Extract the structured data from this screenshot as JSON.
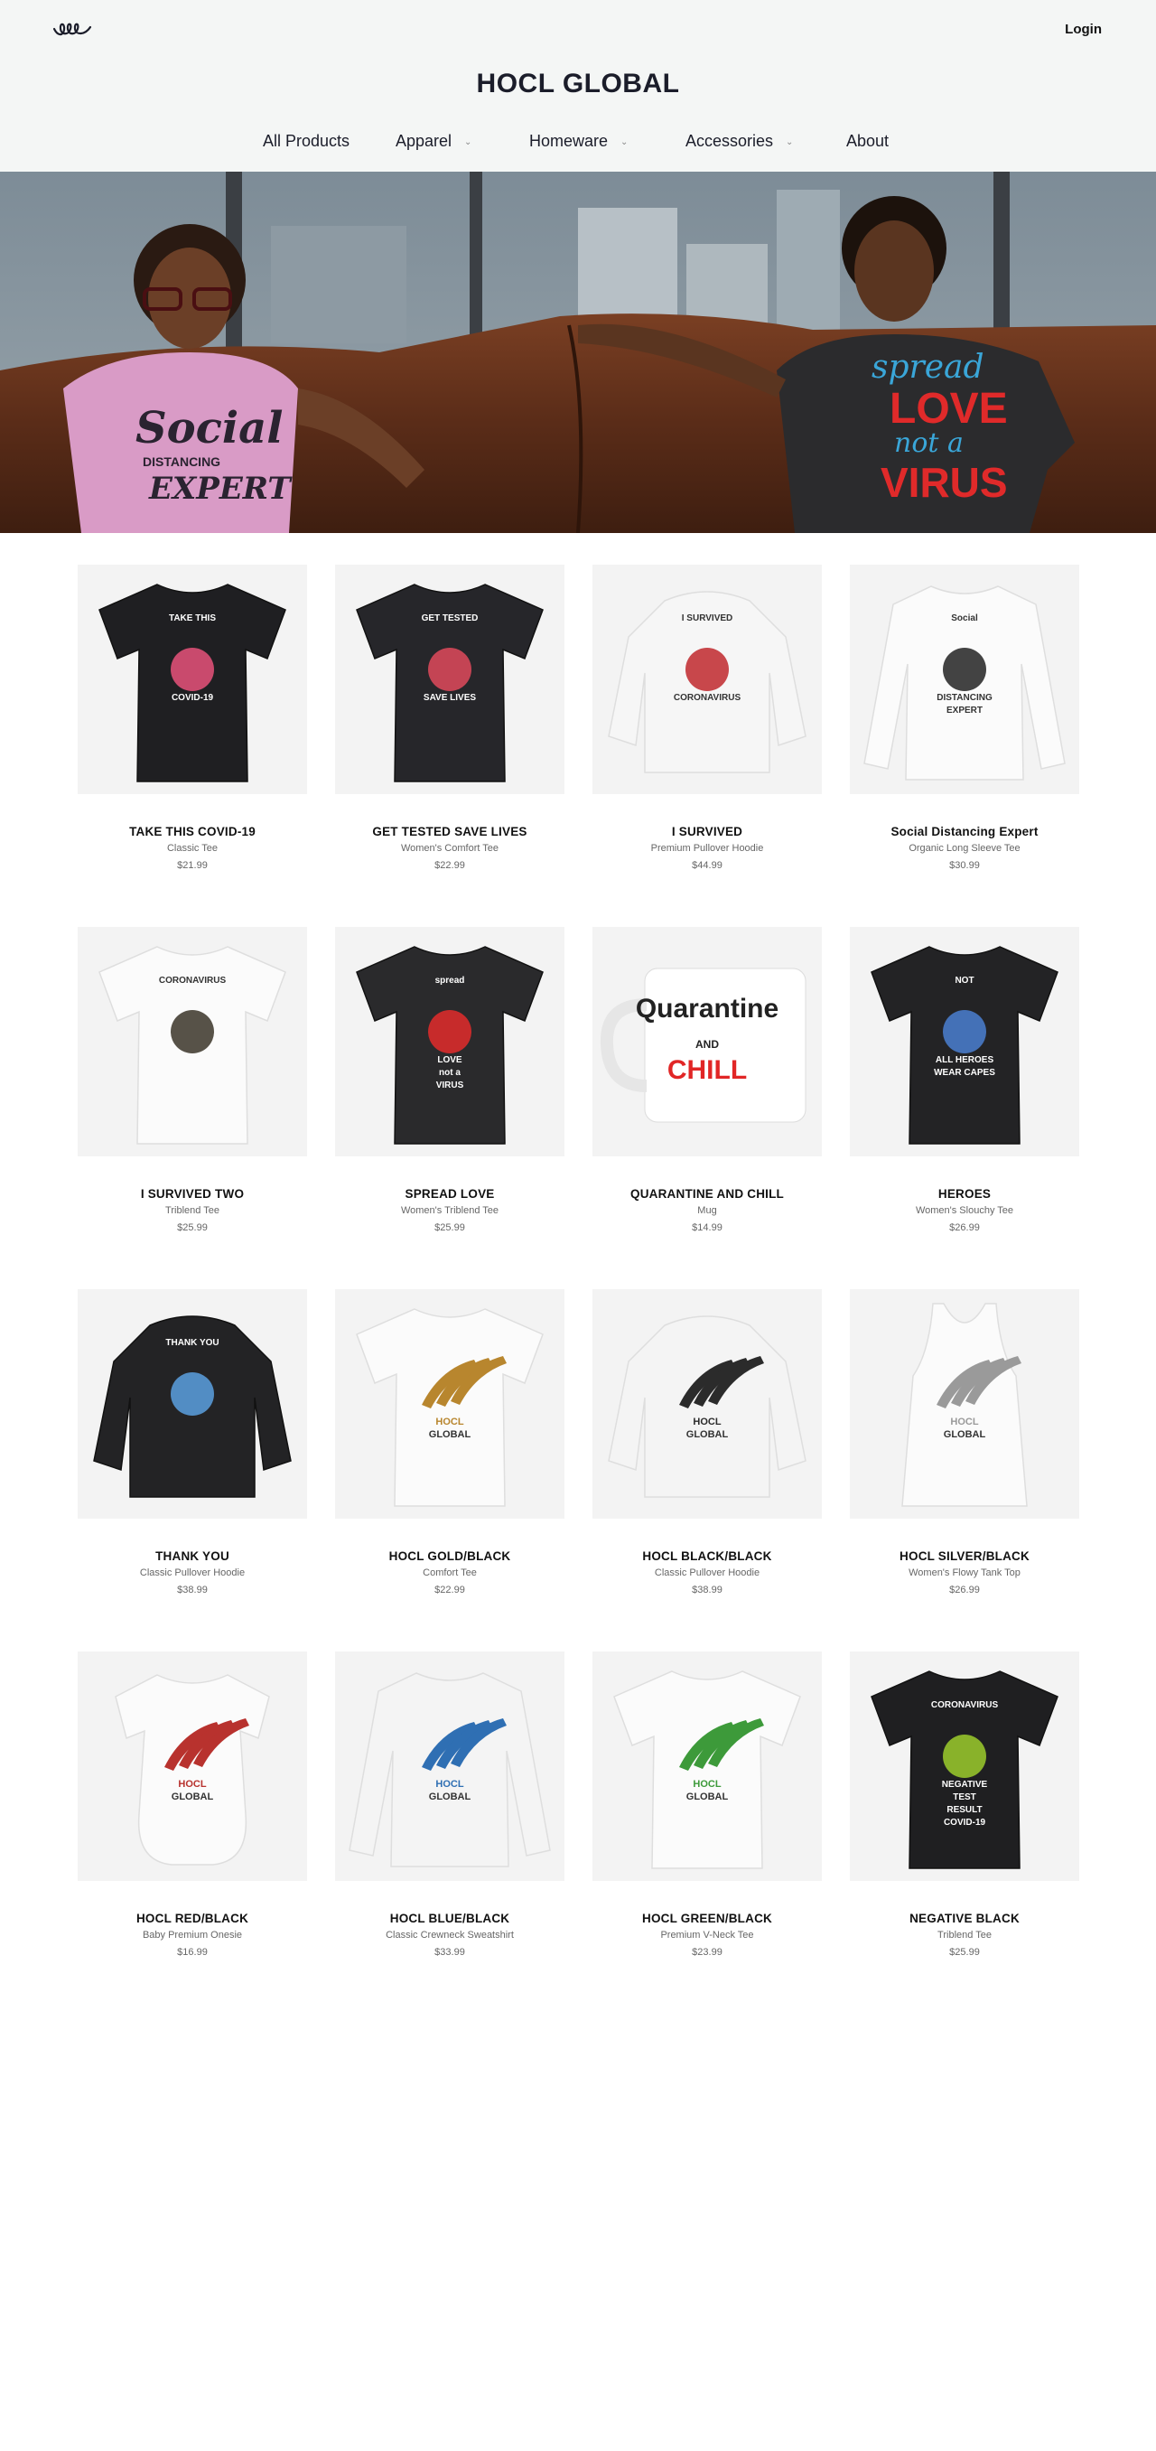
{
  "header": {
    "login_label": "Login",
    "brand_title": "HOCL GLOBAL",
    "logo_icon": "loop-logo-icon"
  },
  "nav": [
    {
      "label": "All Products",
      "has_dropdown": false
    },
    {
      "label": "Apparel",
      "has_dropdown": true
    },
    {
      "label": "Homeware",
      "has_dropdown": true
    },
    {
      "label": "Accessories",
      "has_dropdown": true
    },
    {
      "label": "About",
      "has_dropdown": false
    }
  ],
  "hero": {
    "left_shirt_lines": [
      "Social",
      "DISTANCING",
      "EXPERT"
    ],
    "right_shirt_lines": [
      "spread",
      "LOVE",
      "not a",
      "VIRUS"
    ]
  },
  "products": [
    {
      "name": "TAKE THIS COVID-19",
      "type": "Classic Tee",
      "price": "$21.99",
      "garment": "tee",
      "color": "#1f1f22",
      "print": [
        "TAKE THIS",
        "COVID-19"
      ],
      "accent": "#e8527a"
    },
    {
      "name": "GET TESTED SAVE LIVES",
      "type": "Women's Comfort Tee",
      "price": "$22.99",
      "garment": "tee",
      "color": "#26262a",
      "print": [
        "GET TESTED",
        "SAVE LIVES"
      ],
      "accent": "#e04a5c"
    },
    {
      "name": "I SURVIVED",
      "type": "Premium Pullover Hoodie",
      "price": "$44.99",
      "garment": "hoodie",
      "color": "#f6f6f6",
      "print": [
        "I SURVIVED",
        "CORONAVIRUS"
      ],
      "accent": "#c0282d"
    },
    {
      "name": "Social Distancing Expert",
      "type": "Organic Long Sleeve Tee",
      "price": "$30.99",
      "garment": "longsleeve",
      "color": "#fbfbfb",
      "print": [
        "Social",
        "DISTANCING",
        "EXPERT"
      ],
      "accent": "#222222"
    },
    {
      "name": "I SURVIVED TWO",
      "type": "Triblend Tee",
      "price": "$25.99",
      "garment": "tee",
      "color": "#fbfbfb",
      "print": [
        "CORONAVIRUS"
      ],
      "accent": "#3a3428"
    },
    {
      "name": "SPREAD LOVE",
      "type": "Women's Triblend Tee",
      "price": "$25.99",
      "garment": "tee",
      "color": "#2a2a2c",
      "print": [
        "spread",
        "LOVE",
        "not a",
        "VIRUS"
      ],
      "accent": "#e32b2b"
    },
    {
      "name": "QUARANTINE AND CHILL",
      "type": "Mug",
      "price": "$14.99",
      "garment": "mug",
      "color": "#ffffff",
      "print": [
        "Quarantine",
        "AND",
        "CHILL"
      ],
      "accent": "#e12626"
    },
    {
      "name": "HEROES",
      "type": "Women's Slouchy Tee",
      "price": "$26.99",
      "garment": "tee",
      "color": "#232325",
      "print": [
        "NOT",
        "ALL HEROES",
        "WEAR CAPES"
      ],
      "accent": "#4a7fd1"
    },
    {
      "name": "THANK YOU",
      "type": "Classic Pullover Hoodie",
      "price": "$38.99",
      "garment": "hoodie",
      "color": "#232325",
      "print": [
        "THANK YOU"
      ],
      "accent": "#5aa0e0"
    },
    {
      "name": "HOCL GOLD/BLACK",
      "type": "Comfort Tee",
      "price": "$22.99",
      "garment": "tee",
      "color": "#fbfbfb",
      "print": [
        "HOCL",
        "GLOBAL"
      ],
      "accent": "#b8862e"
    },
    {
      "name": "HOCL BLACK/BLACK",
      "type": "Classic Pullover Hoodie",
      "price": "$38.99",
      "garment": "hoodie",
      "color": "#f4f4f4",
      "print": [
        "HOCL",
        "GLOBAL"
      ],
      "accent": "#2b2b2b"
    },
    {
      "name": "HOCL SILVER/BLACK",
      "type": "Women's Flowy Tank Top",
      "price": "$26.99",
      "garment": "tank",
      "color": "#fbfbfb",
      "print": [
        "HOCL",
        "GLOBAL"
      ],
      "accent": "#9a9a9a"
    },
    {
      "name": "HOCL RED/BLACK",
      "type": "Baby Premium Onesie",
      "price": "$16.99",
      "garment": "onesie",
      "color": "#fbfbfb",
      "print": [
        "HOCL",
        "GLOBAL"
      ],
      "accent": "#b8322e"
    },
    {
      "name": "HOCL BLUE/BLACK",
      "type": "Classic Crewneck Sweatshirt",
      "price": "$33.99",
      "garment": "longsleeve",
      "color": "#f4f4f4",
      "print": [
        "HOCL",
        "GLOBAL"
      ],
      "accent": "#2f6fb3"
    },
    {
      "name": "HOCL GREEN/BLACK",
      "type": "Premium V-Neck Tee",
      "price": "$23.99",
      "garment": "tee",
      "color": "#fbfbfb",
      "print": [
        "HOCL",
        "GLOBAL"
      ],
      "accent": "#3d9a3a"
    },
    {
      "name": "NEGATIVE BLACK",
      "type": "Triblend Tee",
      "price": "$25.99",
      "garment": "tee",
      "color": "#1f1f21",
      "print": [
        "CORONAVIRUS",
        "NEGATIVE",
        "TEST",
        "RESULT",
        "COVID-19"
      ],
      "accent": "#9ccc2c"
    }
  ]
}
